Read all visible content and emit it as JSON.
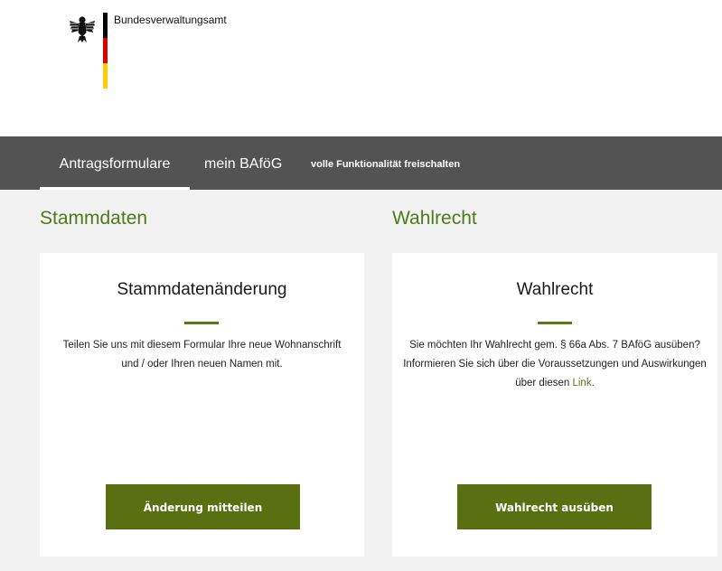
{
  "header": {
    "agency_name": "Bundesverwaltungsamt",
    "flag_colors": [
      "#000000",
      "#dd0000",
      "#ffce00"
    ]
  },
  "nav": {
    "items": [
      {
        "label": "Antragsformulare",
        "active": true
      },
      {
        "label": "mein BAföG",
        "active": false
      },
      {
        "label": "volle Funktionalität freischalten",
        "active": false
      }
    ]
  },
  "sections": [
    {
      "heading": "Stammdaten",
      "card": {
        "title": "Stammdatenänderung",
        "text": "Teilen Sie uns mit diesem Formular Ihre neue Wohnanschrift und / oder Ihren neuen Namen mit.",
        "button_label": "Änderung mitteilen"
      }
    },
    {
      "heading": "Wahlrecht",
      "card": {
        "title": "Wahlrecht",
        "text_before_link": "Sie möchten Ihr Wahlrecht gem. § 66a Abs. 7 BAföG ausüben? Informieren Sie sich über die Voraussetzungen und Auswirkungen über diesen ",
        "link_label": "Link",
        "text_after_link": ".",
        "button_label": "Wahlrecht ausüben"
      }
    }
  ],
  "colors": {
    "accent_green": "#4d7a1a",
    "button_green": "#5a6e12",
    "nav_background": "#535353"
  },
  "icons": {
    "logo": "federal-eagle-icon"
  }
}
